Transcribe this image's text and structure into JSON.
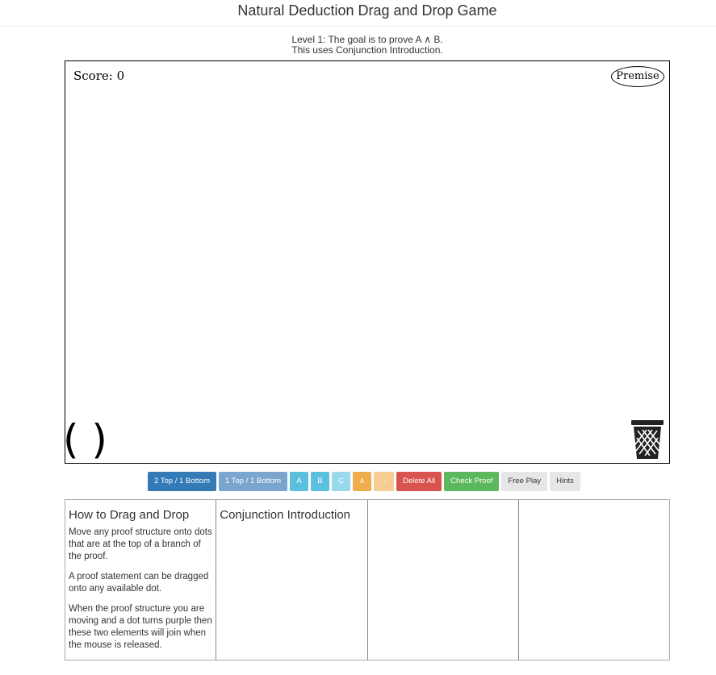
{
  "header": {
    "title": "Natural Deduction Drag and Drop Game"
  },
  "goal": {
    "line1": "Level 1: The goal is to prove A ∧ B.",
    "line2": "This uses Conjunction Introduction."
  },
  "board": {
    "score_text": "Score: 0",
    "premise_label": "Premise",
    "paren_tool": "( )",
    "trash_icon": "trash-icon"
  },
  "toolbar": {
    "buttons": [
      {
        "label": "2 Top / 1 Bottom",
        "color": "#337ab7"
      },
      {
        "label": "1 Top / 1 Bottom",
        "color": "#7aa5cf"
      },
      {
        "label": "A",
        "color": "#5bc0de"
      },
      {
        "label": "B",
        "color": "#5bc0de"
      },
      {
        "label": "C",
        "color": "#9ad9ec"
      },
      {
        "label": "∧",
        "color": "#f0ad4e"
      },
      {
        "label": "→",
        "color": "#f6cd92"
      },
      {
        "label": "Delete All",
        "color": "#d9534f"
      },
      {
        "label": "Check Proof",
        "color": "#5cb85c"
      },
      {
        "label": "Free Play",
        "color": "#e6e6e6"
      },
      {
        "label": "Hints",
        "color": "#e6e6e6"
      }
    ]
  },
  "panels": {
    "how_to": {
      "title": "How to Drag and Drop",
      "paragraphs": [
        "Move any proof structure onto dots that are at the top of a branch of the proof.",
        "A proof statement can be dragged onto any available dot.",
        "When the proof structure you are moving and a dot turns purple then these two elements will join when the mouse is released."
      ]
    },
    "rule": {
      "title": "Conjunction Introduction"
    }
  }
}
